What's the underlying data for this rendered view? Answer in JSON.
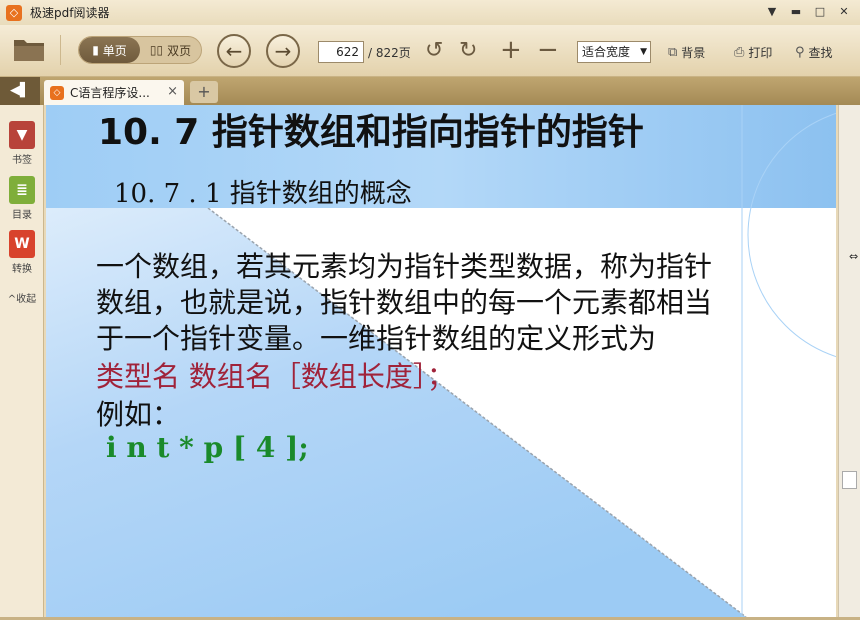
{
  "window": {
    "title": "极速pdf阅读器",
    "logo_char": "◇"
  },
  "toolbar": {
    "single_page": "单页",
    "double_page": "双页",
    "current_page": "622",
    "total_pages": "/ 822页",
    "zoom_value": "适合宽度",
    "background_label": "背景",
    "print_label": "打印",
    "search_label": "查找"
  },
  "tabs": {
    "active_title": "C语言程序设...",
    "close_char": "×",
    "new_tab_char": "+"
  },
  "sidebar": {
    "bookmark_label": "书签",
    "toc_label": "目录",
    "convert_label": "转换",
    "collapse_label": "^收起"
  },
  "page": {
    "heading": "10. 7 指针数组和指向指针的指针",
    "subheading": "10. 7 . 1 指针数组的概念",
    "para_line1": "一个数组，若其元素均为指针类型数据，称为指针",
    "para_line2": "数组，也就是说，指针数组中的每一个元素都相当",
    "para_line3": "于一个指针变量。一维指针数组的定义形式为",
    "syntax_line": "类型名   数组名［数组长度］；",
    "example_label": "例如：",
    "code_line": "i n t   * p [ 4 ];"
  },
  "colors": {
    "syntax_red": "#a0233a",
    "code_green": "#1a8a2a",
    "band_blue": "#8ec3f2"
  }
}
